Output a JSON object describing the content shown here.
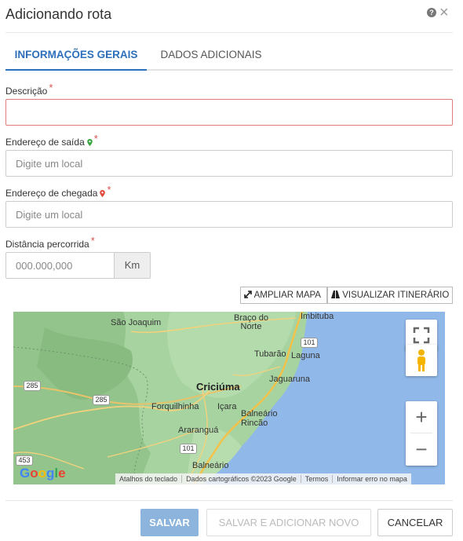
{
  "dialog": {
    "title": "Adicionando rota",
    "help_icon_glyph": "?",
    "close_icon_glyph": "×"
  },
  "tabs": [
    {
      "label": "INFORMAÇÕES GERAIS",
      "active": true
    },
    {
      "label": "DADOS ADICIONAIS",
      "active": false
    }
  ],
  "form": {
    "descricao": {
      "label": "Descrição",
      "required_mark": "*",
      "value": "",
      "placeholder": ""
    },
    "saida": {
      "label": "Endereço de saída",
      "required_mark": "*",
      "icon": "green-pin-icon",
      "value": "",
      "placeholder": "Digite um local"
    },
    "chegada": {
      "label": "Endereço de chegada",
      "required_mark": "*",
      "icon": "red-pin-icon",
      "value": "",
      "placeholder": "Digite um local"
    },
    "distancia": {
      "label": "Distância percorrida",
      "required_mark": "*",
      "value": "",
      "placeholder": "000.000,000",
      "unit": "Km"
    }
  },
  "map_buttons": {
    "ampliar": "AMPLIAR MAPA",
    "itinerario": "VISUALIZAR ITINERÁRIO"
  },
  "map": {
    "places": [
      "São Joaquim",
      "Braço do Norte",
      "Imbituba",
      "Tubarão",
      "Laguna",
      "Jaguaruna",
      "Criciúma",
      "Forquilhinha",
      "Içara",
      "Balneário Rincão",
      "Araranguá",
      "Balneário"
    ],
    "roads": [
      "101",
      "285",
      "285",
      "101",
      "453"
    ],
    "zoom_in": "+",
    "zoom_out": "−",
    "logo": "Google",
    "attribution": [
      "Atalhos do teclado",
      "Dados cartográficos ©2023 Google",
      "Termos",
      "Informar erro no mapa"
    ]
  },
  "footer": {
    "save": "SALVAR",
    "save_new": "SALVAR E ADICIONAR NOVO",
    "cancel": "CANCELAR"
  },
  "colors": {
    "accent": "#2c6fbb",
    "required": "#d9534f",
    "save_disabled": "#8cb4dd"
  }
}
